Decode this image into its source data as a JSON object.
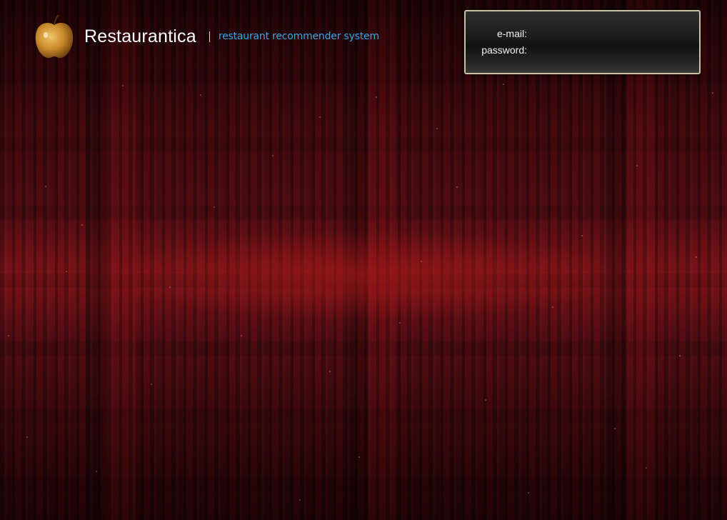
{
  "header": {
    "brand_name": "Restaurantica",
    "tagline": "restaurant recommender system",
    "logo_icon": "golden-apple-icon",
    "tagline_color": "#3aa6e6"
  },
  "login": {
    "email_label": "e-mail:",
    "email_value": "",
    "password_label": "password:",
    "password_value": "",
    "border_color": "#c9c2a0"
  },
  "theme": {
    "background": "#3a0a0e",
    "accent": "#7a1418"
  }
}
